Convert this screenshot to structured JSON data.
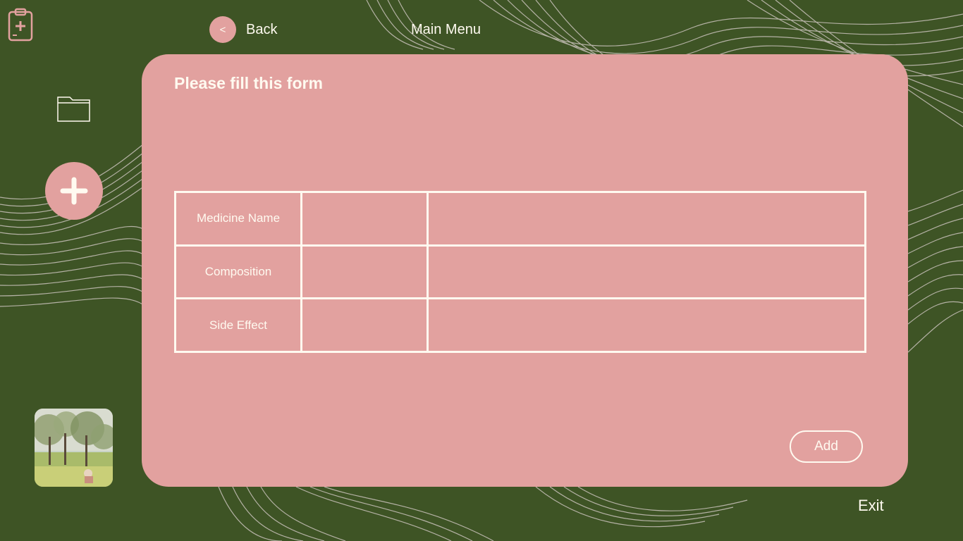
{
  "header": {
    "back_icon": "<",
    "back_label": "Back",
    "main_menu_label": "Main Menu"
  },
  "sidebar": {
    "logo_icon": "clipboard-medical-icon",
    "folder_icon": "folder-icon",
    "add_icon": "plus-icon",
    "thumbnail": "landscape-painting-thumbnail"
  },
  "form": {
    "title": "Please fill this form",
    "rows": [
      {
        "label": "Medicine Name",
        "value": "",
        "extra": ""
      },
      {
        "label": "Composition",
        "value": "",
        "extra": ""
      },
      {
        "label": "Side Effect",
        "value": "",
        "extra": ""
      }
    ],
    "add_label": "Add"
  },
  "footer": {
    "exit_label": "Exit"
  },
  "colors": {
    "background": "#3e5425",
    "card": "#e2a19f",
    "text": "#fffaf0",
    "lines": "#c9c2bb"
  }
}
